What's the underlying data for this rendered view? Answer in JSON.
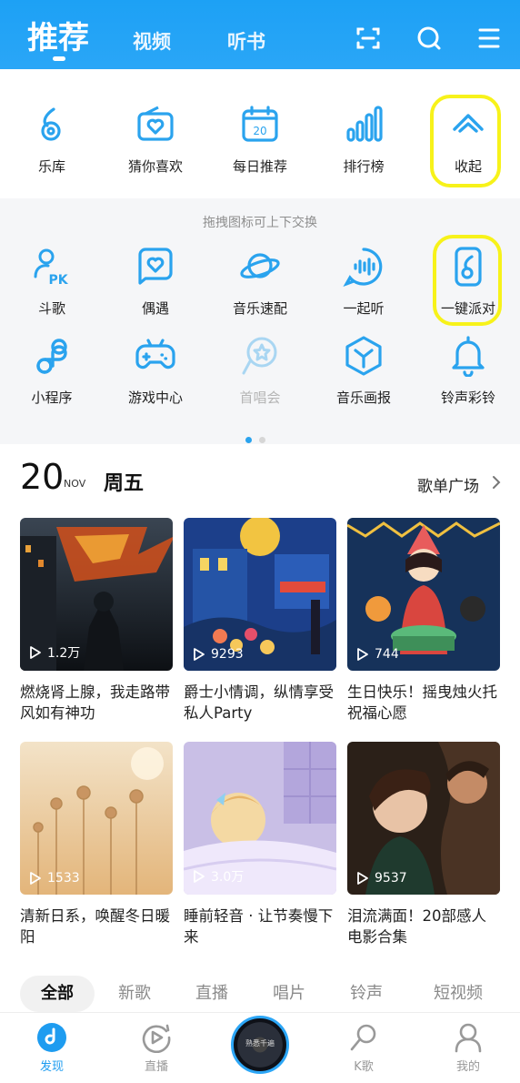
{
  "header": {
    "tabs": [
      {
        "label": "推荐",
        "active": true
      },
      {
        "label": "视频",
        "active": false
      },
      {
        "label": "听书",
        "active": false
      }
    ],
    "icons": [
      "scan-icon",
      "search-icon",
      "menu-icon"
    ],
    "color": "#1da1f5"
  },
  "quick_entries": [
    {
      "label": "乐库",
      "icon": "music-library-icon"
    },
    {
      "label": "猜你喜欢",
      "icon": "radio-heart-icon"
    },
    {
      "label": "每日推荐",
      "icon": "calendar-icon",
      "day": "20"
    },
    {
      "label": "排行榜",
      "icon": "ranking-bars-icon"
    },
    {
      "label": "收起",
      "icon": "collapse-chevron-icon",
      "highlighted": true
    }
  ],
  "drawer": {
    "hint": "拖拽图标可上下交换",
    "row1": [
      {
        "label": "斗歌",
        "icon": "pk-icon"
      },
      {
        "label": "偶遇",
        "icon": "chat-heart-icon"
      },
      {
        "label": "音乐速配",
        "icon": "planet-icon"
      },
      {
        "label": "一起听",
        "icon": "listen-together-icon"
      },
      {
        "label": "一键派对",
        "icon": "party-phone-icon",
        "highlighted": true
      }
    ],
    "row2": [
      {
        "label": "小程序",
        "icon": "mini-program-icon"
      },
      {
        "label": "游戏中心",
        "icon": "gamepad-icon"
      },
      {
        "label": "首唱会",
        "icon": "debut-concert-icon",
        "disabled": true
      },
      {
        "label": "音乐画报",
        "icon": "cube-icon"
      },
      {
        "label": "铃声彩铃",
        "icon": "bell-icon"
      }
    ],
    "page_dots": {
      "count": 2,
      "active": 0
    }
  },
  "date_header": {
    "day": "20",
    "month": "NOV",
    "weekday": "周五",
    "link": "歌单广场"
  },
  "playlists": [
    {
      "plays": "1.2万",
      "title": "燃烧肾上腺，我走路带风如有神功",
      "theme": "dark-city"
    },
    {
      "plays": "9293",
      "title": "爵士小情调，纵情享受私人Party",
      "theme": "jazz-street"
    },
    {
      "plays": "744",
      "title": "生日快乐！摇曳烛火托祝福心愿",
      "theme": "birthday"
    },
    {
      "plays": "1533",
      "title": "清新日系，唤醒冬日暖阳",
      "theme": "warm-flowers"
    },
    {
      "plays": "3.0万",
      "title": "睡前轻音 · 让节奏慢下来",
      "theme": "sleep"
    },
    {
      "plays": "9537",
      "title": "泪流满面！20部感人电影合集",
      "theme": "film"
    }
  ],
  "categories": [
    {
      "label": "全部",
      "active": true
    },
    {
      "label": "新歌",
      "active": false
    },
    {
      "label": "直播",
      "active": false
    },
    {
      "label": "唱片",
      "active": false
    },
    {
      "label": "铃声",
      "active": false
    },
    {
      "label": "短视频",
      "active": false
    }
  ],
  "bottom_nav": [
    {
      "label": "发现",
      "icon": "discover-icon",
      "active": true
    },
    {
      "label": "直播",
      "icon": "live-play-icon",
      "active": false
    },
    {
      "label": "K歌",
      "icon": "karaoke-mic-icon",
      "active": false
    },
    {
      "label": "我的",
      "icon": "profile-icon",
      "active": false
    }
  ],
  "player": {
    "disc_text": "熟悉千遍"
  }
}
